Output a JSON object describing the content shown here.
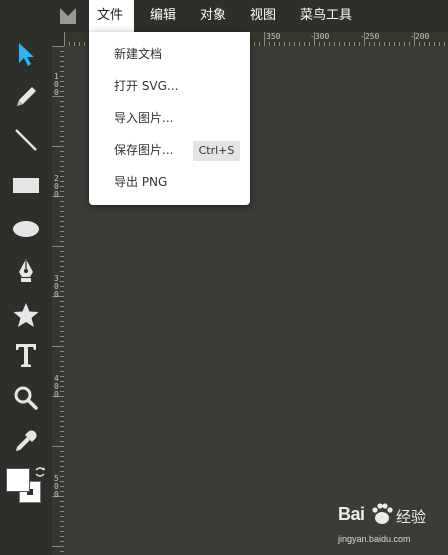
{
  "menubar": {
    "items": [
      {
        "label": "文件",
        "active": true
      },
      {
        "label": "编辑",
        "active": false
      },
      {
        "label": "对象",
        "active": false
      },
      {
        "label": "视图",
        "active": false
      },
      {
        "label": "菜鸟工具",
        "active": false
      }
    ]
  },
  "file_menu": {
    "items": [
      {
        "label": "新建文档"
      },
      {
        "label": "打开 SVG..."
      },
      {
        "label": "导入图片..."
      },
      {
        "label": "保存图片...",
        "shortcut": "Ctrl+S"
      },
      {
        "label": "导出 PNG"
      }
    ]
  },
  "toolbar": {
    "tools": [
      {
        "icon": "select-arrow-icon",
        "active": true
      },
      {
        "icon": "pencil-icon"
      },
      {
        "icon": "line-icon"
      },
      {
        "icon": "rectangle-icon"
      },
      {
        "icon": "ellipse-icon"
      },
      {
        "icon": "pen-nib-icon"
      },
      {
        "icon": "star-icon"
      },
      {
        "icon": "text-icon"
      },
      {
        "icon": "zoom-icon"
      },
      {
        "icon": "eyedropper-icon"
      }
    ],
    "fill_color": "#ffffff",
    "stroke_color": "#ffffff"
  },
  "ruler": {
    "top_labels": [
      "350",
      "-300",
      "-250",
      "-200"
    ],
    "left_labels": [
      "1",
      "0",
      "0",
      "2",
      "0",
      "0",
      "3",
      "0",
      "0",
      "4",
      "0",
      "0",
      "5",
      "0",
      "0"
    ]
  },
  "colors": {
    "accent": "#29b6f6",
    "background": "#3b3b37",
    "panel": "#2e2e2b"
  },
  "watermark": {
    "brand": "Bai",
    "label": "经验",
    "site": "jingyan.baidu.com"
  }
}
